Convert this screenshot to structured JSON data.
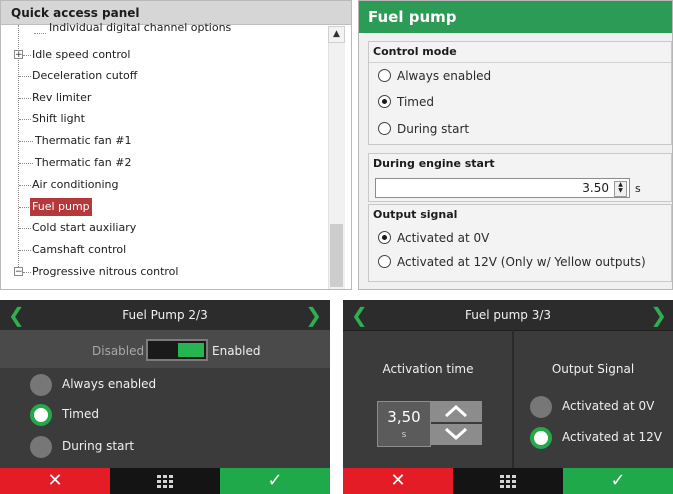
{
  "tree_panel": {
    "title": "Quick access panel",
    "items": [
      {
        "label": "Individual digital channel options"
      },
      {
        "label": "Idle speed control",
        "expander": "+"
      },
      {
        "label": "Deceleration cutoff"
      },
      {
        "label": "Rev limiter"
      },
      {
        "label": "Shift light"
      },
      {
        "label": "Thermatic fan #1"
      },
      {
        "label": "Thermatic fan #2"
      },
      {
        "label": "Air conditioning"
      },
      {
        "label": "Fuel pump",
        "selected": true
      },
      {
        "label": "Cold start auxiliary"
      },
      {
        "label": "Camshaft control"
      },
      {
        "label": "Progressive nitrous control",
        "expander": "−"
      }
    ]
  },
  "fuel_pump_panel": {
    "title": "Fuel pump",
    "control_mode": {
      "title": "Control mode",
      "options": [
        "Always enabled",
        "Timed",
        "During start"
      ],
      "selected": "Timed"
    },
    "engine_start": {
      "title": "During engine start",
      "value": "3.50",
      "unit": "s"
    },
    "output_signal": {
      "title": "Output signal",
      "options": [
        "Activated at 0V",
        "Activated at 12V (Only w/ Yellow outputs)"
      ],
      "selected": "Activated at 0V"
    }
  },
  "screen2": {
    "title": "Fuel Pump 2/3",
    "left_arrow": "❮",
    "right_arrow": "❯",
    "toggle_off_label": "Disabled",
    "toggle_on_label": "Enabled",
    "toggle_state": "enabled",
    "options": [
      "Always enabled",
      "Timed",
      "During start"
    ],
    "selected": "Timed"
  },
  "screen3": {
    "title": "Fuel pump 3/3",
    "left_arrow": "❮",
    "right_arrow": "❯",
    "activation_label": "Activation time",
    "value": "3,50",
    "unit": "s",
    "output_label": "Output Signal",
    "options": [
      "Activated at 0V",
      "Activated at 12V"
    ],
    "selected": "Activated at 12V"
  },
  "footer": {
    "cancel_symbol": "✕",
    "ok_symbol": "✓"
  },
  "colors": {
    "accent_green": "#2c9b56",
    "device_green": "#1fa94a",
    "cancel_red": "#e31c25",
    "selected_tree_item": "#b5383a"
  }
}
